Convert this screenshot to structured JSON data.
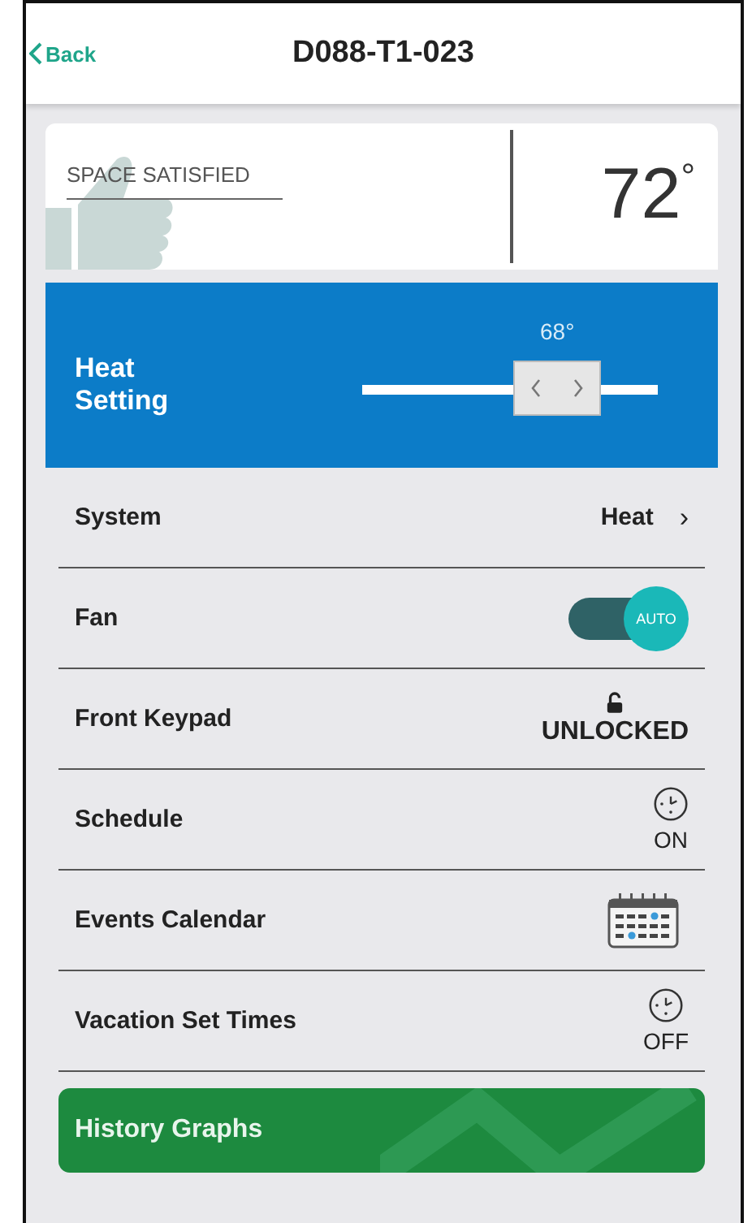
{
  "header": {
    "back": "Back",
    "title": "D088-T1-023"
  },
  "status_card": {
    "status": "SPACE SATISFIED",
    "temperature": "72",
    "degree": "°"
  },
  "setpoint": {
    "label": "Heat Setting",
    "value": "68°",
    "level": 0.66
  },
  "rows": [
    {
      "kind": "link",
      "label": "System",
      "value": "Heat",
      "chevron": "›"
    },
    {
      "kind": "toggle",
      "label": "Fan",
      "on": true,
      "knob": "AUTO"
    },
    {
      "kind": "lock",
      "label": "Front Keypad",
      "locked": false,
      "value": "UNLOCKED"
    },
    {
      "kind": "clock",
      "label": "Schedule",
      "value": "ON"
    },
    {
      "kind": "calendar",
      "label": "Events Calendar"
    },
    {
      "kind": "clock",
      "label": "Vacation Set Times",
      "value": "OFF"
    }
  ],
  "history_button": {
    "label": "History Graphs"
  }
}
